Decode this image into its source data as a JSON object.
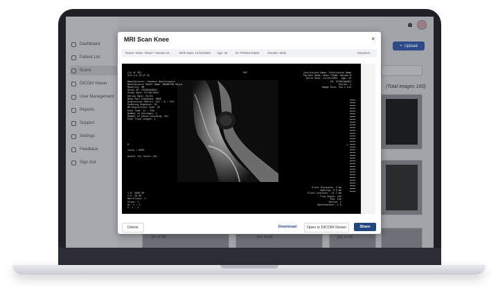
{
  "sidebar": {
    "items": [
      {
        "label": "Dashboard",
        "icon": "dashboard-icon"
      },
      {
        "label": "Patient List",
        "icon": "patient-list-icon"
      },
      {
        "label": "Scans",
        "icon": "scans-icon",
        "active": true
      },
      {
        "label": "DICOM Viewer",
        "icon": "dicom-viewer-icon"
      },
      {
        "label": "User Management",
        "icon": "users-icon"
      },
      {
        "label": "Reports",
        "icon": "reports-icon"
      },
      {
        "label": "Support",
        "icon": "support-icon"
      },
      {
        "label": "Settings",
        "icon": "settings-icon"
      },
      {
        "label": "Feedback",
        "icon": "feedback-icon"
      },
      {
        "label": "Sign Out",
        "icon": "sign-out-icon"
      }
    ]
  },
  "header": {
    "upload_label": "Upload"
  },
  "gallery": {
    "total_label": "(Total images 160)",
    "captions": [
      "[11 of 20]",
      "[6/1 of 20]",
      "[6/1 of 20]"
    ]
  },
  "modal": {
    "title": "MRI Scan Knee",
    "close": "×",
    "info": {
      "name": "Name: Khan \"Sham\" Hassan M...",
      "birth": "Birth Date: 14/10/1984",
      "age": "Age: 34",
      "id": "ID: PI0001A6653",
      "gender": "Gender: Male",
      "status": "Mosaic/a"
    },
    "viewer": {
      "top_left": "[11 of 20]\n4/0-1/4 (% of AL\n\nManufacturer: Siemens Healthineers\nManufacturer Model Name: MAGNETOM Skyra\nModality: MR\nStudy ID: PI0001A6653\nStudy Date: 07/06/2024\nSeries Date: 01/04\nBody Part Examined: KNEE\nAcquisition Matrix: 512 : 0 : 512\nScanning Sequence: SE\nMR Acquisition Type: 2D\nEcho Time: 12 : 256\nNumber of Averages: 1\nNumber of phase encoding: 101\nEcho Train Length: 1",
      "top_center": "SUP",
      "top_right": "Institution Name: Institution Name\nPatient Name: Khan \"Sham\" Hassan M\nBirth Date: 14/10/1984   Age: 34\nID: PI0001A6653\nSeries: 1\nImage Size: 512 x 512",
      "mid_left": "R\n\nlossy = 0000\n\nwidth= 121 level= 101",
      "mid_right": "L",
      "bottom_left": "T.R. 3000.00\nT.E. 26.00\nNex/Slices: 1\nSlice: 1\nAL: 1 : 1\nC: 1 : 1",
      "bottom_right": "Slice Thickness: 3 mm\nSpacing: 3.3 mm\nSlice Location: -11.7 mm\nFlip Angle: 150\nFOV: 150\nSeries: 1\nSpheremother: 1.0"
    },
    "buttons": {
      "delete": "Delete",
      "download": "Download",
      "open_dicom": "Open in DICOM Viewer",
      "share": "Share"
    }
  },
  "colors": {
    "primary": "#24467f",
    "bezel": "#1f2126",
    "overlay": "#8b8e94"
  }
}
